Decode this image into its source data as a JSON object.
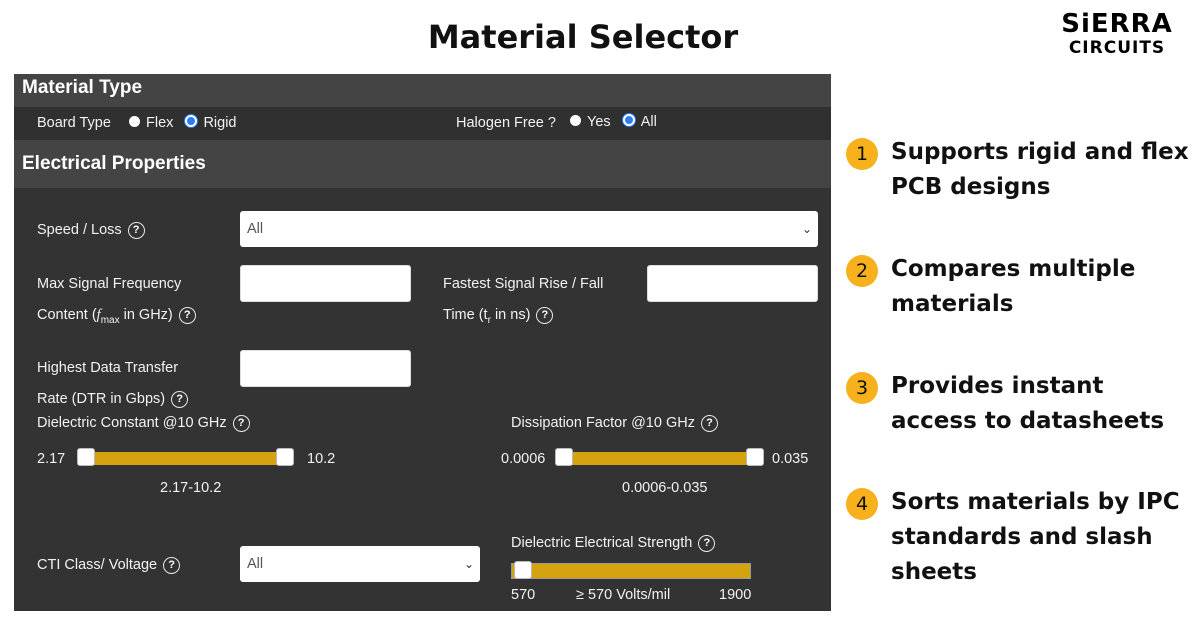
{
  "title": "Material Selector",
  "logo": {
    "top": "SiERRA",
    "bottom": "CIRCUITS"
  },
  "material_type": {
    "header": "Material Type",
    "board_type": {
      "label": "Board Type",
      "options": [
        "Flex",
        "Rigid"
      ],
      "selected": "Rigid"
    },
    "halogen_free": {
      "label": "Halogen Free ?",
      "options": [
        "Yes",
        "All"
      ],
      "selected": "All"
    }
  },
  "electrical": {
    "header": "Electrical Properties",
    "speed_loss": {
      "label": "Speed / Loss",
      "value": "All"
    },
    "max_signal_freq": {
      "label_line1": "Max Signal Frequency",
      "label_line2_pre": "Content (",
      "label_f": "f",
      "label_sub": "max",
      "label_line2_post": " in GHz)",
      "value": ""
    },
    "rise_fall": {
      "label_line1": "Fastest Signal Rise / Fall",
      "label_line2_pre": "Time (t",
      "label_sub": "r",
      "label_line2_post": " in ns)",
      "value": ""
    },
    "dtr": {
      "label_line1": "Highest Data Transfer",
      "label_line2": "Rate (DTR in Gbps)",
      "value": ""
    },
    "dielectric_constant": {
      "label": "Dielectric Constant @10 GHz",
      "min": "2.17",
      "max": "10.2",
      "range": "2.17-10.2",
      "low": 0,
      "high": 1
    },
    "dissipation_factor": {
      "label": "Dissipation Factor @10 GHz",
      "min": "0.0006",
      "max": "0.035",
      "range": "0.0006-0.035",
      "low": 0,
      "high": 1
    },
    "cti": {
      "label": "CTI Class/ Voltage",
      "value": "All"
    },
    "dielectric_strength": {
      "label": "Dielectric Electrical Strength",
      "min": "570",
      "max": "1900",
      "current": "≥  570 Volts/mil",
      "level": 0
    }
  },
  "help_glyph": "?",
  "chevron": "⌄",
  "features": [
    {
      "num": "1",
      "text": "Supports rigid and flex PCB designs"
    },
    {
      "num": "2",
      "text": "Compares multiple materials"
    },
    {
      "num": "3",
      "text": "Provides instant access to datasheets"
    },
    {
      "num": "4",
      "text": "Sorts materials by IPC standards and slash sheets"
    }
  ],
  "colors": {
    "accent": "#d5a30f",
    "badge": "#f6b11c",
    "panel": "#333333",
    "header": "#444444",
    "radio_selected": "#2d7df7"
  }
}
